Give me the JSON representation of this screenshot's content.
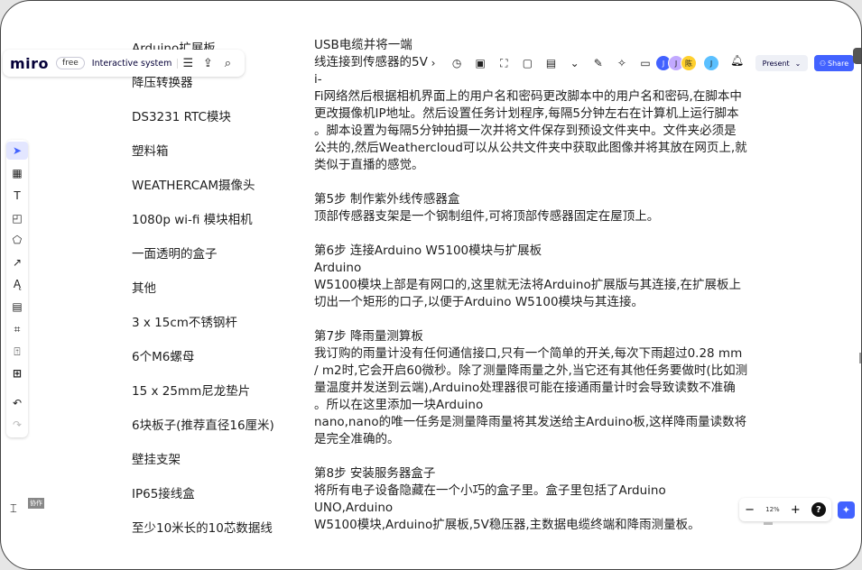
{
  "app": {
    "logo": "miro",
    "plan": "free",
    "board_name": "Interactive system"
  },
  "topbar": {
    "left_icons": [
      "menu-icon",
      "upload-icon",
      "search-icon"
    ],
    "mid_icons": [
      "chevron-right-icon",
      "timer-icon",
      "card-icon",
      "focus-icon",
      "number-icon",
      "doc-icon",
      "chevron-down-icon",
      "pen-icon",
      "reaction-icon",
      "comment-icon"
    ],
    "avatars": [
      "J",
      "J",
      "陈",
      "J"
    ],
    "present_label": "Present",
    "share_label": "Share"
  },
  "tools": [
    "select-icon",
    "template-icon",
    "text-icon",
    "sticky-note-icon",
    "shapes-icon",
    "arrow-icon",
    "pen-icon",
    "comment-icon",
    "frame-icon",
    "upload-icon",
    "add-icon",
    "undo-icon",
    "redo-icon"
  ],
  "left_column": [
    "Arduino扩展板",
    "降压转换器",
    "DS3231 RTC模块",
    "塑料箱",
    "WEATHERCAM摄像头",
    "1080p wi-fi 模块相机",
    "一面透明的盒子",
    "其他",
    "3 x 15cm不锈钢杆",
    "6个M6螺母",
    "15 x 25mm尼龙垫片",
    "6块板子(推荐直径16厘米)",
    "壁挂支架",
    "IP65接线盒",
    "至少10米长的10芯数据线"
  ],
  "right_column": [
    "USB电缆并将一端",
    "线连接到传感器的5V",
    "i-",
    "Fi网络然后根据相机界面上的用户名和密码更改脚本中的用户名和密码,在脚本中",
    "更改摄像机IP地址。然后设置任务计划程序,每隔5分钟左右在计算机上运行脚本",
    "。脚本设置为每隔5分钟拍摄一次并将文件保存到预设文件夹中。文件夹必须是",
    "公共的,然后Weathercloud可以从公共文件夹中获取此图像并将其放在网页上,就",
    "类似于直播的感觉。",
    "",
    "第5步 制作紫外线传感器盒",
    "顶部传感器支架是一个钢制组件,可将顶部传感器固定在屋顶上。",
    "",
    "第6步 连接Arduino W5100模块与扩展板",
    "Arduino",
    "W5100模块上部是有网口的,这里就无法将Arduino扩展版与其连接,在扩展板上",
    "切出一个矩形的口子,以便于Arduino W5100模块与其连接。",
    "",
    "第7步 降雨量测算板",
    "我订购的雨量计没有任何通信接口,只有一个简单的开关,每次下雨超过0.28 mm",
    "/ m2时,它会开启60微秒。除了测量降雨量之外,当它还有其他任务要做时(比如测",
    "量温度并发送到云端),Arduino处理器很可能在接通雨量计时会导致读数不准确",
    "。所以在这里添加一块Arduino",
    "nano,nano的唯一任务是测量降雨量将其发送给主Arduino板,这样降雨量读数将",
    "是完全准确的。",
    "",
    "第8步 安装服务器盒子",
    "将所有电子设备隐藏在一个小巧的盒子里。盒子里包括了Arduino",
    "UNO,Arduino",
    "W5100模块,Arduino扩展板,5V稳压器,主数据电缆终端和降雨测量板。"
  ],
  "bottom": {
    "frame_label": "协作",
    "zoom_minus": "−",
    "zoom_value": "12%",
    "zoom_plus": "+",
    "help": "?"
  }
}
